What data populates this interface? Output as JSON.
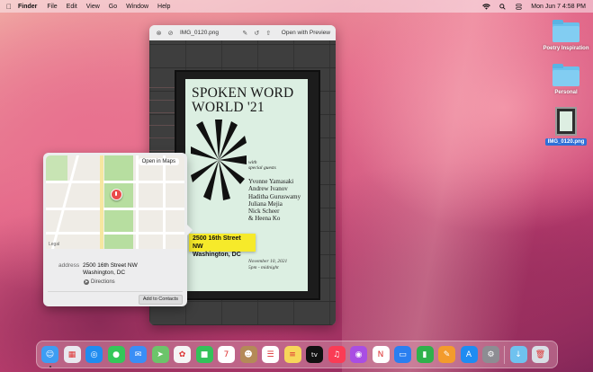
{
  "menubar": {
    "app_name": "Finder",
    "menus": [
      "File",
      "Edit",
      "View",
      "Go",
      "Window",
      "Help"
    ],
    "clock": "Mon Jun 7  4:58 PM"
  },
  "desktop": {
    "items": [
      {
        "label": "Poetry Inspiration",
        "type": "folder"
      },
      {
        "label": "Personal",
        "type": "folder"
      },
      {
        "label": "IMG_0120.png",
        "type": "file",
        "selected": true
      }
    ]
  },
  "quicklook": {
    "title": "IMG_0120.png",
    "open_with": "Open with Preview"
  },
  "poster": {
    "title_line1": "SPOKEN WORD",
    "title_line2": "WORLD '21",
    "with": "with",
    "special_guests": "special guests",
    "guests": [
      "Yvonne Yamasaki",
      "Andrew Ivanov",
      "Haditha Guruswamy",
      "Juliana Mejia",
      "Nick Scheer",
      "& Heena Ko"
    ],
    "date": "November 10, 2021",
    "time": "5pm - midnight"
  },
  "detected_address": {
    "line1": "2500 16th Street NW",
    "line2": "Washington, DC"
  },
  "map_popover": {
    "open_in_maps": "Open in Maps",
    "legal": "Legal",
    "address_key": "address",
    "address_line1": "2500 16th Street NW",
    "address_line2": "Washington, DC",
    "directions": "Directions",
    "add_to_contacts": "Add to Contacts"
  },
  "dock": {
    "apps": [
      {
        "name": "finder-icon",
        "color": "#3d9df3",
        "glyph": "☺"
      },
      {
        "name": "launchpad-icon",
        "color": "#e9e9ef",
        "glyph": "▦"
      },
      {
        "name": "safari-icon",
        "color": "#1f8cf0",
        "glyph": "◎"
      },
      {
        "name": "messages-icon",
        "color": "#34c759",
        "glyph": "●"
      },
      {
        "name": "mail-icon",
        "color": "#3a8ef6",
        "glyph": "✉"
      },
      {
        "name": "maps-icon",
        "color": "#6cc46a",
        "glyph": "➤"
      },
      {
        "name": "photos-icon",
        "color": "#f5f5f5",
        "glyph": "✿"
      },
      {
        "name": "facetime-icon",
        "color": "#33c25a",
        "glyph": "■"
      },
      {
        "name": "calendar-icon",
        "color": "#ffffff",
        "glyph": "7"
      },
      {
        "name": "contacts-icon",
        "color": "#b48a58",
        "glyph": "☻"
      },
      {
        "name": "reminders-icon",
        "color": "#ffffff",
        "glyph": "☰"
      },
      {
        "name": "notes-icon",
        "color": "#f7d65a",
        "glyph": "≡"
      },
      {
        "name": "tv-icon",
        "color": "#111111",
        "glyph": "tv"
      },
      {
        "name": "music-icon",
        "color": "#fa3c55",
        "glyph": "♫"
      },
      {
        "name": "podcasts-icon",
        "color": "#a94ee3",
        "glyph": "◉"
      },
      {
        "name": "news-icon",
        "color": "#ffffff",
        "glyph": "N"
      },
      {
        "name": "keynote-icon",
        "color": "#2a7ff0",
        "glyph": "▭"
      },
      {
        "name": "numbers-icon",
        "color": "#2fb14b",
        "glyph": "▮"
      },
      {
        "name": "pages-icon",
        "color": "#f39b2c",
        "glyph": "✎"
      },
      {
        "name": "app-store-icon",
        "color": "#1e8cf1",
        "glyph": "A"
      },
      {
        "name": "system-preferences-icon",
        "color": "#8d8d93",
        "glyph": "⚙"
      },
      {
        "name": "downloads-folder-icon",
        "color": "#6fc2ef",
        "glyph": "↓"
      },
      {
        "name": "trash-icon",
        "color": "#d9dfe6",
        "glyph": "🗑"
      }
    ]
  }
}
